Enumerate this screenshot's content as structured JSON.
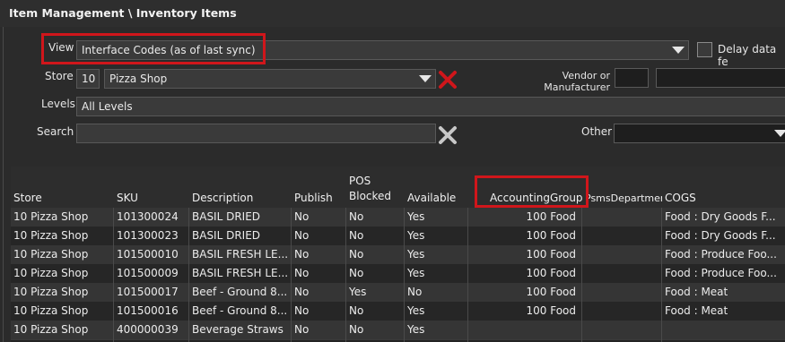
{
  "window": {
    "title": "Item Management \\ Inventory Items"
  },
  "filters": {
    "view_label": "View",
    "view_value": "Interface Codes (as of last sync)",
    "delay_label": "Delay data fe",
    "store_label": "Store",
    "store_number": "10",
    "store_name": "Pizza Shop",
    "vendor_label_line1": "Vendor or",
    "vendor_label_line2": "Manufacturer",
    "levels_label": "Levels",
    "levels_value": "All Levels",
    "search_label": "Search",
    "search_value": "",
    "other_label": "Other",
    "other_value": ""
  },
  "table": {
    "headers": {
      "store": "Store",
      "sku": "SKU",
      "description": "Description",
      "publish": "Publish",
      "pos_blocked_line1": "POS",
      "pos_blocked_line2": "Blocked",
      "available": "Available",
      "accounting_group": "AccountingGroup",
      "psms_department": "PsmsDepartment",
      "cogs": "COGS"
    },
    "rows": [
      {
        "store": "10 Pizza Shop",
        "sku": "101300024",
        "description": "BASIL DRIED",
        "publish": "No",
        "pos_blocked": "No",
        "available": "Yes",
        "accounting_group": "100 Food",
        "psms_department": "",
        "cogs": "Food : Dry Goods F..."
      },
      {
        "store": "10 Pizza Shop",
        "sku": "101300023",
        "description": "BASIL DRIED",
        "publish": "No",
        "pos_blocked": "No",
        "available": "Yes",
        "accounting_group": "100 Food",
        "psms_department": "",
        "cogs": "Food : Dry Goods F..."
      },
      {
        "store": "10 Pizza Shop",
        "sku": "101500010",
        "description": "BASIL FRESH LE...",
        "publish": "No",
        "pos_blocked": "No",
        "available": "Yes",
        "accounting_group": "100 Food",
        "psms_department": "",
        "cogs": "Food : Produce Foo..."
      },
      {
        "store": "10 Pizza Shop",
        "sku": "101500009",
        "description": "BASIL FRESH LE...",
        "publish": "No",
        "pos_blocked": "No",
        "available": "Yes",
        "accounting_group": "100 Food",
        "psms_department": "",
        "cogs": "Food : Produce Foo..."
      },
      {
        "store": "10 Pizza Shop",
        "sku": "101500017",
        "description": "Beef - Ground 8...",
        "publish": "No",
        "pos_blocked": "Yes",
        "available": "No",
        "accounting_group": "100 Food",
        "psms_department": "",
        "cogs": "Food : Meat"
      },
      {
        "store": "10 Pizza Shop",
        "sku": "101500016",
        "description": "Beef - Ground 8...",
        "publish": "No",
        "pos_blocked": "No",
        "available": "Yes",
        "accounting_group": "100 Food",
        "psms_department": "",
        "cogs": "Food : Meat"
      },
      {
        "store": "10 Pizza Shop",
        "sku": "400000039",
        "description": "Beverage Straws",
        "publish": "No",
        "pos_blocked": "No",
        "available": "Yes",
        "accounting_group": "",
        "psms_department": "",
        "cogs": ""
      }
    ]
  },
  "colors": {
    "highlight_red": "#d0161b",
    "clear_red": "#d0161b",
    "clear_gray": "#c8c8c8"
  },
  "icons": {
    "dropdown": "chevron-down-icon",
    "clear_store": "red-x-icon",
    "clear_search": "gray-x-icon"
  }
}
